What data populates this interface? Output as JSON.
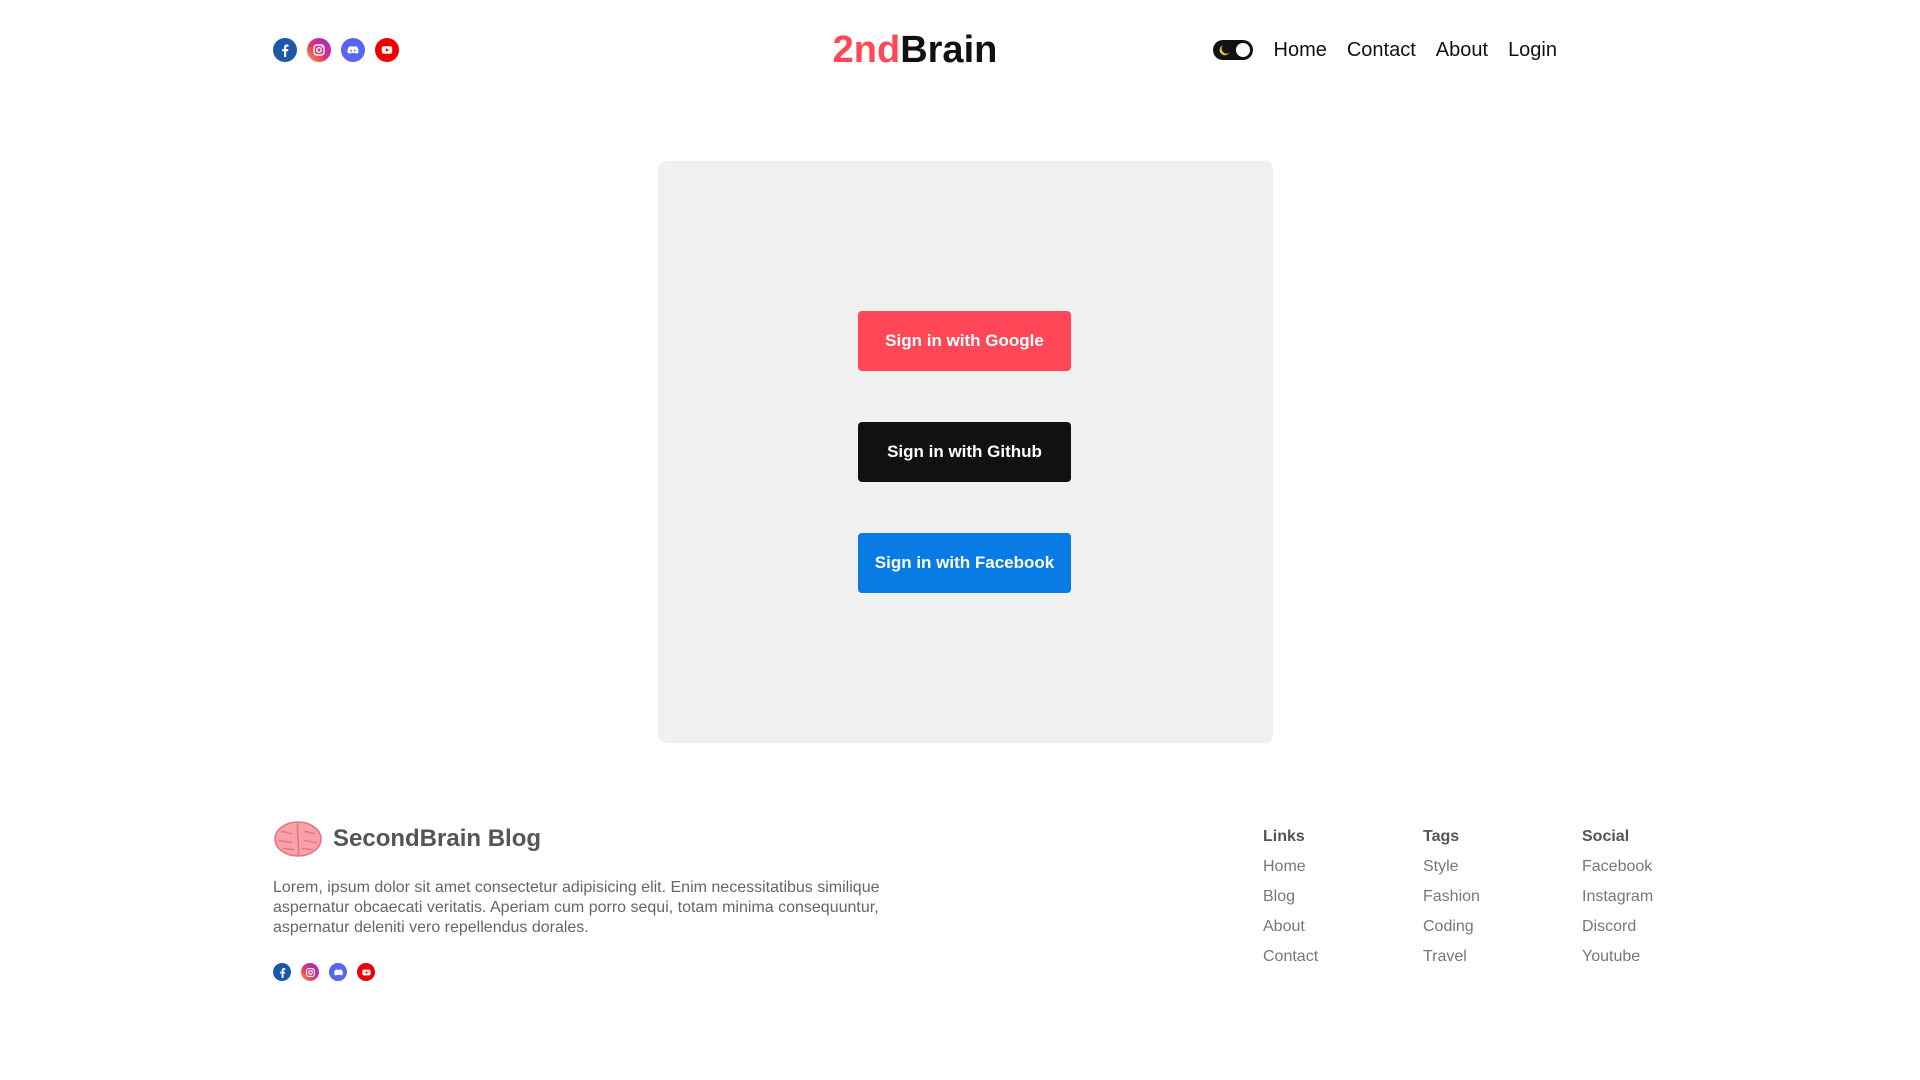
{
  "header": {
    "logo_accent": "2nd",
    "logo_main": "Brain",
    "nav": {
      "home": "Home",
      "contact": "Contact",
      "about": "About",
      "login": "Login"
    },
    "socials": [
      "facebook-icon",
      "instagram-icon",
      "discord-icon",
      "youtube-icon"
    ],
    "theme_toggle_icon": "moon-icon"
  },
  "login": {
    "google": "Sign in with Google",
    "github": "Sign in with Github",
    "facebook": "Sign in with Facebook"
  },
  "footer": {
    "brand_icon": "brain-icon",
    "brand_name": "SecondBrain Blog",
    "description": "Lorem, ipsum dolor sit amet consectetur adipisicing elit. Enim necessitatibus similique aspernatur obcaecati veritatis. Aperiam cum porro sequi, totam minima consequuntur, aspernatur deleniti vero repellendus dorales.",
    "links": {
      "title": "Links",
      "items": [
        "Home",
        "Blog",
        "About",
        "Contact"
      ]
    },
    "tags": {
      "title": "Tags",
      "items": [
        "Style",
        "Fashion",
        "Coding",
        "Travel"
      ]
    },
    "social": {
      "title": "Social",
      "items": [
        "Facebook",
        "Instagram",
        "Discord",
        "Youtube"
      ]
    }
  },
  "colors": {
    "accent": "#ff4757",
    "github": "#111111",
    "facebook": "#087be4",
    "card_bg": "#f0f0f0"
  }
}
